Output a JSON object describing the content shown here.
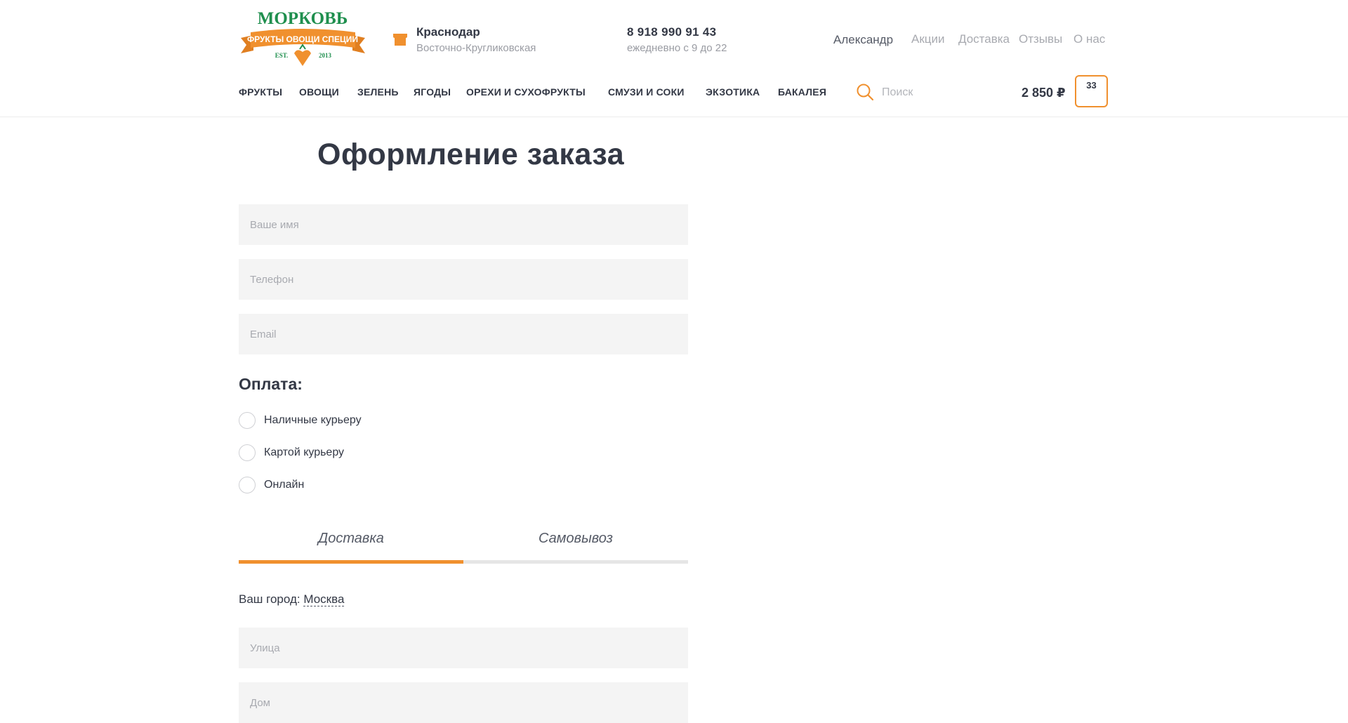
{
  "header": {
    "logo": {
      "brand": "МОРКОВЬ",
      "tagline": "ФРУКТЫ ОВОЩИ СПЕЦИИ",
      "est_left": "EST.",
      "est_right": "2013"
    },
    "store": {
      "city": "Краснодар",
      "address": "Восточно-Кругликовская"
    },
    "contact": {
      "phone": "8 918 990 91 43",
      "hours": "ежедневно с 9 до 22"
    },
    "user_name": "Александр",
    "top_links": [
      "Акции",
      "Доставка",
      "Отзывы",
      "О нас"
    ],
    "nav": [
      "ФРУКТЫ",
      "ОВОЩИ",
      "ЗЕЛЕНЬ",
      "ЯГОДЫ",
      "ОРЕХИ И СУХОФРУКТЫ",
      "СМУЗИ И СОКИ",
      "ЭКЗОТИКА",
      "БАКАЛЕЯ"
    ],
    "search_placeholder": "Поиск",
    "cart": {
      "total": "2 850 ₽",
      "count": "33"
    }
  },
  "form": {
    "title": "Оформление заказа",
    "name_placeholder": "Ваше имя",
    "phone_placeholder": "Телефон",
    "email_placeholder": "Email",
    "payment_title": "Оплата:",
    "payment_options": [
      "Наличные курьеру",
      "Картой курьеру",
      "Онлайн"
    ],
    "tabs": [
      "Доставка",
      "Самовывоз"
    ],
    "city_label": "Ваш город:",
    "city_value": "Москва",
    "street_placeholder": "Улица",
    "house_placeholder": "Дом"
  },
  "colors": {
    "accent": "#f0902e",
    "brand_green": "#1f8f4e",
    "text_dark": "#333845",
    "muted": "#a8aab0",
    "field_bg": "#f4f4f4"
  }
}
